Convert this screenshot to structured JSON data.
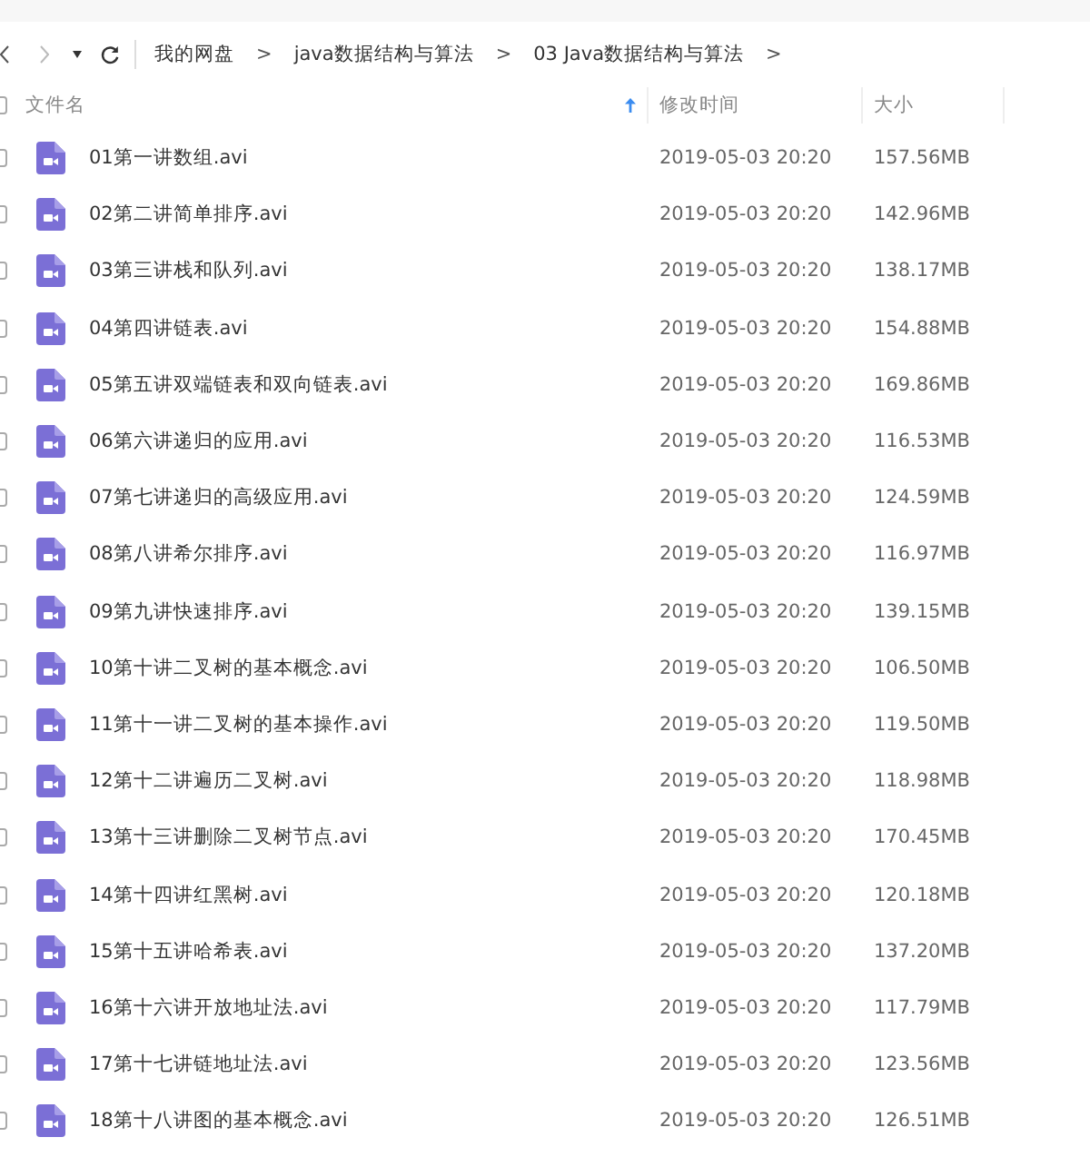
{
  "breadcrumbs": [
    {
      "label": "我的网盘",
      "separator": ">"
    },
    {
      "label": "java数据结构与算法",
      "separator": ">"
    },
    {
      "label": "03 Java数据结构与算法",
      "separator": ">"
    }
  ],
  "table": {
    "select_all": {
      "checked": false
    },
    "columns": [
      {
        "label": "文件名",
        "sorted": true
      },
      {
        "label": "修改时间",
        "sorted": false
      },
      {
        "label": "大小",
        "sorted": false
      }
    ],
    "rows": [
      {
        "name": "01第一讲数组.avi",
        "modified": "2019-05-03 20:20",
        "size": "157.56MB",
        "checked": false
      },
      {
        "name": "02第二讲简单排序.avi",
        "modified": "2019-05-03 20:20",
        "size": "142.96MB",
        "checked": false
      },
      {
        "name": "03第三讲栈和队列.avi",
        "modified": "2019-05-03 20:20",
        "size": "138.17MB",
        "checked": false
      },
      {
        "name": "04第四讲链表.avi",
        "modified": "2019-05-03 20:20",
        "size": "154.88MB",
        "checked": false
      },
      {
        "name": "05第五讲双端链表和双向链表.avi",
        "modified": "2019-05-03 20:20",
        "size": "169.86MB",
        "checked": false
      },
      {
        "name": "06第六讲递归的应用.avi",
        "modified": "2019-05-03 20:20",
        "size": "116.53MB",
        "checked": false
      },
      {
        "name": "07第七讲递归的高级应用.avi",
        "modified": "2019-05-03 20:20",
        "size": "124.59MB",
        "checked": false
      },
      {
        "name": "08第八讲希尔排序.avi",
        "modified": "2019-05-03 20:20",
        "size": "116.97MB",
        "checked": false
      },
      {
        "name": "09第九讲快速排序.avi",
        "modified": "2019-05-03 20:20",
        "size": "139.15MB",
        "checked": false
      },
      {
        "name": "10第十讲二叉树的基本概念.avi",
        "modified": "2019-05-03 20:20",
        "size": "106.50MB",
        "checked": false
      },
      {
        "name": "11第十一讲二叉树的基本操作.avi",
        "modified": "2019-05-03 20:20",
        "size": "119.50MB",
        "checked": false
      },
      {
        "name": "12第十二讲遍历二叉树.avi",
        "modified": "2019-05-03 20:20",
        "size": "118.98MB",
        "checked": false
      },
      {
        "name": "13第十三讲删除二叉树节点.avi",
        "modified": "2019-05-03 20:20",
        "size": "170.45MB",
        "checked": false
      },
      {
        "name": "14第十四讲红黑树.avi",
        "modified": "2019-05-03 20:20",
        "size": "120.18MB",
        "checked": false
      },
      {
        "name": "15第十五讲哈希表.avi",
        "modified": "2019-05-03 20:20",
        "size": "137.20MB",
        "checked": false
      },
      {
        "name": "16第十六讲开放地址法.avi",
        "modified": "2019-05-03 20:20",
        "size": "117.79MB",
        "checked": false
      },
      {
        "name": "17第十七讲链地址法.avi",
        "modified": "2019-05-03 20:20",
        "size": "123.56MB",
        "checked": false
      },
      {
        "name": "18第十八讲图的基本概念.avi",
        "modified": "2019-05-03 20:20",
        "size": "126.51MB",
        "checked": false
      }
    ]
  }
}
